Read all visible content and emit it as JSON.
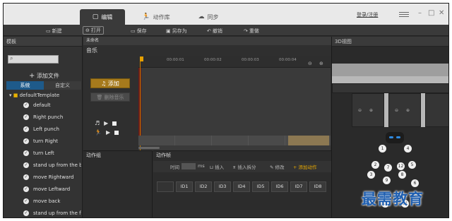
{
  "titlebar": {
    "tabs": [
      {
        "label": "编辑",
        "icon": "edit-icon",
        "active": true
      },
      {
        "label": "动作库",
        "icon": "runner-icon",
        "active": false
      },
      {
        "label": "同步",
        "icon": "cloud-sync-icon",
        "active": false
      }
    ],
    "login_label": "登录/注册",
    "window_controls": [
      "settings-icon",
      "minimize-icon",
      "maximize-icon",
      "close-icon"
    ]
  },
  "toolbar": {
    "items": [
      {
        "label": "新建",
        "icon": "new-icon"
      },
      {
        "label": "打开",
        "icon": "open-icon",
        "active": true
      },
      {
        "label": "保存",
        "icon": "save-icon"
      },
      {
        "label": "另存为",
        "icon": "save-as-icon"
      },
      {
        "label": "撤销",
        "icon": "undo-icon"
      },
      {
        "label": "重做",
        "icon": "redo-icon"
      }
    ]
  },
  "templates": {
    "title": "模板",
    "search_placeholder": "",
    "add_file_label": "添加文件",
    "tabs": [
      {
        "label": "系统",
        "active": true
      },
      {
        "label": "自定义",
        "active": false
      }
    ],
    "root_label": "defaultTemplate",
    "items": [
      "default",
      "Right punch",
      "Left punch",
      "turn Right",
      "turn Left",
      "stand up from the b...",
      "move Rightward",
      "move Leftward",
      "move back",
      "stand up from the fr..."
    ]
  },
  "music": {
    "untitled_label": "未命名",
    "title": "音乐",
    "add_label": "添加",
    "delete_label": "删除音乐",
    "ticks": [
      "00:00:01",
      "00:00:02",
      "00:00:03",
      "00:00:04"
    ]
  },
  "action_group": {
    "title": "动作组"
  },
  "action_frames": {
    "title": "动作帧",
    "time_label": "时间",
    "time_unit": "ms",
    "insert_label": "插入",
    "insert_split_label": "插入拆分",
    "modify_label": "修改",
    "add_action_label": "添加动作",
    "ids": [
      "ID1",
      "ID2",
      "ID3",
      "ID4",
      "ID5",
      "ID6",
      "ID7",
      "ID8"
    ]
  },
  "view3d": {
    "title": "3D视图",
    "joints": [
      "1",
      "4",
      "2",
      "7",
      "12",
      "5",
      "8",
      "9",
      "6",
      "3",
      "10",
      "11"
    ]
  },
  "watermark": "最需教育",
  "colors": {
    "accent": "#e8a800",
    "active_tab": "#1e5a8a",
    "background": "#2b2b2b"
  }
}
